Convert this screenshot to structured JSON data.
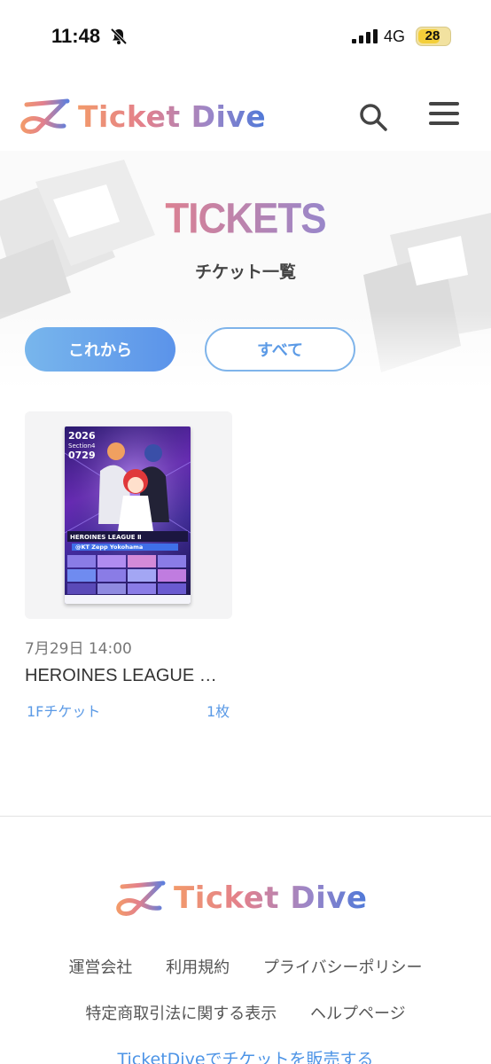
{
  "status_bar": {
    "time": "11:48",
    "network": "4G",
    "battery": "28",
    "icons": [
      "bell-slash-icon",
      "signal-icon",
      "battery-icon"
    ]
  },
  "header": {
    "brand": "Ticket Dive",
    "icons": [
      "search-icon",
      "hamburger-menu-icon"
    ]
  },
  "hero": {
    "title": "TICKETS",
    "subtitle": "チケット一覧"
  },
  "filters": {
    "upcoming": "これから",
    "all": "すべて"
  },
  "tickets": [
    {
      "date": "7月29日 14:00",
      "title": "HEROINES LEAGUE …",
      "ticket_type": "1Fチケット",
      "quantity": "1枚",
      "poster_text": {
        "year": "2026",
        "section": "Section4",
        "date": "0729",
        "event": "HEROINES LEAGUE Ⅱ",
        "venue": "@KT Zepp Yokohama"
      }
    }
  ],
  "footer": {
    "brand": "Ticket Dive",
    "links_row1": [
      "運営会社",
      "利用規約",
      "プライバシーポリシー"
    ],
    "links_row2": [
      "特定商取引法に関する表示",
      "ヘルプページ"
    ],
    "seller_link": "TicketDiveでチケットを販売する"
  },
  "colors": {
    "accent_blue": "#5b93ea",
    "gradient": [
      "#f29a6b",
      "#e3808c",
      "#9b86c8",
      "#4f79d8"
    ]
  }
}
